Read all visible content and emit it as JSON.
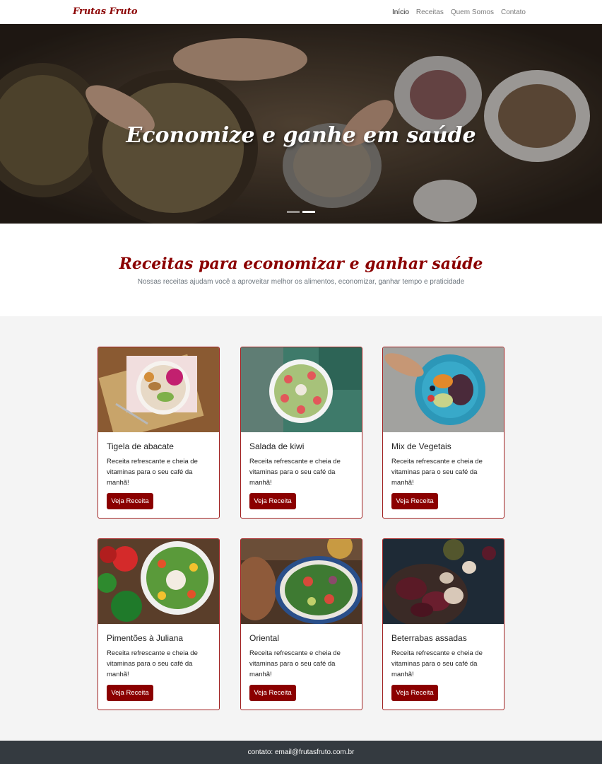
{
  "navbar": {
    "brand": "Frutas Fruto",
    "links": [
      {
        "label": "Início",
        "active": true
      },
      {
        "label": "Receitas",
        "active": false
      },
      {
        "label": "Quem Somos",
        "active": false
      },
      {
        "label": "Contato",
        "active": false
      }
    ]
  },
  "hero": {
    "title": "Economize e ganhe em saúde",
    "slides": 2,
    "active_slide": 2
  },
  "section": {
    "title": "Receitas para economizar e ganhar saúde",
    "subtitle": "Nossas receitas ajudam você a aproveitar melhor os alimentos, economizar, ganhar tempo e praticidade"
  },
  "cards": [
    {
      "title": "Tigela de abacate",
      "text": "Receita refrescante e cheia de vitaminas para o seu café da manhã!",
      "button": "Veja Receita"
    },
    {
      "title": "Salada de kiwi",
      "text": "Receita refrescante e cheia de vitaminas para o seu café da manhã!",
      "button": "Veja Receita"
    },
    {
      "title": "Mix de Vegetais",
      "text": "Receita refrescante e cheia de vitaminas para o seu café da manhã!",
      "button": "Veja Receita"
    },
    {
      "title": "Pimentões à Juliana",
      "text": "Receita refrescante e cheia de vitaminas para o seu café da manhã!",
      "button": "Veja Receita"
    },
    {
      "title": "Oriental",
      "text": "Receita refrescante e cheia de vitaminas para o seu café da manhã!",
      "button": "Veja Receita"
    },
    {
      "title": "Beterrabas assadas",
      "text": "Receita refrescante e cheia de vitaminas para o seu café da manhã!",
      "button": "Veja Receita"
    }
  ],
  "footer": {
    "text": "contato: email@frutasfruto.com.br"
  },
  "colors": {
    "brand": "#8b0000",
    "footer_bg": "#343a40",
    "cards_bg": "#f4f4f4"
  }
}
